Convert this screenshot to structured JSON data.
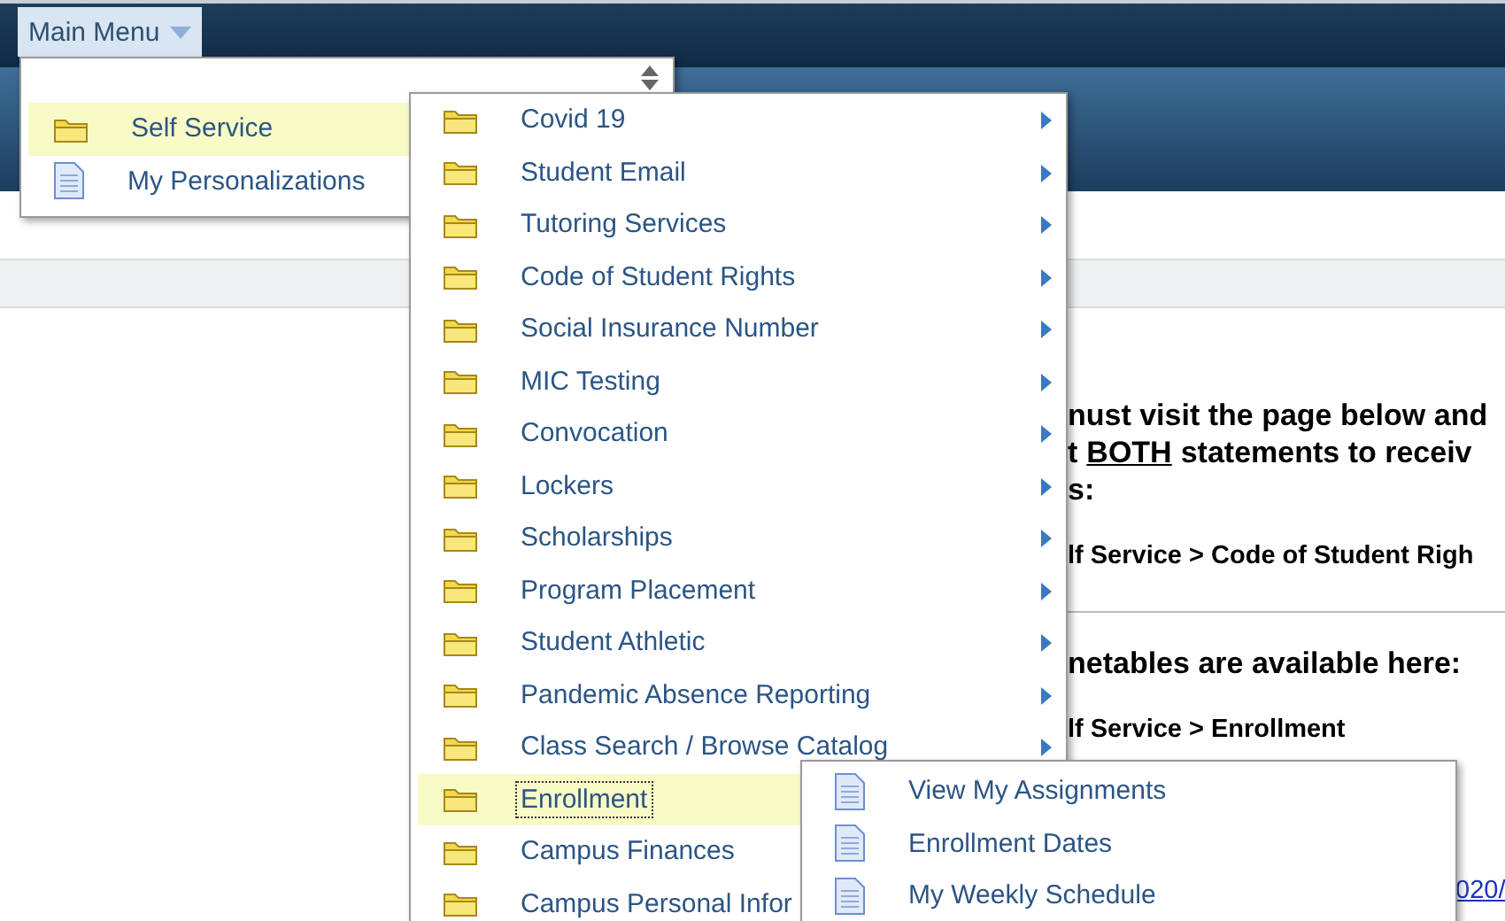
{
  "main_menu": {
    "label": "Main Menu"
  },
  "menu": {
    "items": [
      {
        "label": "Self Service",
        "kind": "folder",
        "selected": true
      },
      {
        "label": "My Personalizations",
        "kind": "page",
        "selected": false
      }
    ]
  },
  "submenu": {
    "items": [
      {
        "label": "Covid 19",
        "kind": "folder",
        "selected": false,
        "focused": false,
        "submenu": true
      },
      {
        "label": "Student Email",
        "kind": "folder",
        "selected": false,
        "focused": false,
        "submenu": true
      },
      {
        "label": "Tutoring Services",
        "kind": "folder",
        "selected": false,
        "focused": false,
        "submenu": true
      },
      {
        "label": "Code of Student Rights",
        "kind": "folder",
        "selected": false,
        "focused": false,
        "submenu": true
      },
      {
        "label": "Social Insurance Number",
        "kind": "folder",
        "selected": false,
        "focused": false,
        "submenu": true
      },
      {
        "label": "MIC Testing",
        "kind": "folder",
        "selected": false,
        "focused": false,
        "submenu": true
      },
      {
        "label": "Convocation",
        "kind": "folder",
        "selected": false,
        "focused": false,
        "submenu": true
      },
      {
        "label": "Lockers",
        "kind": "folder",
        "selected": false,
        "focused": false,
        "submenu": true
      },
      {
        "label": "Scholarships",
        "kind": "folder",
        "selected": false,
        "focused": false,
        "submenu": true
      },
      {
        "label": "Program Placement",
        "kind": "folder",
        "selected": false,
        "focused": false,
        "submenu": true
      },
      {
        "label": "Student Athletic",
        "kind": "folder",
        "selected": false,
        "focused": false,
        "submenu": true
      },
      {
        "label": "Pandemic Absence Reporting",
        "kind": "folder",
        "selected": false,
        "focused": false,
        "submenu": true
      },
      {
        "label": "Class Search / Browse Catalog",
        "kind": "folder",
        "selected": false,
        "focused": false,
        "submenu": true
      },
      {
        "label": "Enrollment",
        "kind": "folder",
        "selected": true,
        "focused": true
      },
      {
        "label": "Campus Finances",
        "kind": "folder",
        "selected": false,
        "focused": false
      },
      {
        "label": "Campus Personal Infor",
        "kind": "folder",
        "selected": false,
        "focused": false
      }
    ]
  },
  "enrollment_menu": {
    "items": [
      {
        "label": "View My Assignments",
        "kind": "page"
      },
      {
        "label": "Enrollment Dates",
        "kind": "page"
      },
      {
        "label": "My Weekly Schedule",
        "kind": "page"
      }
    ]
  },
  "content": {
    "blocks": [
      {
        "kind": "heading",
        "parts": [
          {
            "text": "nust visit the page below and"
          }
        ]
      },
      {
        "kind": "heading",
        "parts": [
          {
            "text": "t"
          },
          {
            "text": "BOTH",
            "underline": true
          },
          {
            "text": "statements to receiv"
          }
        ]
      },
      {
        "kind": "heading",
        "parts": [
          {
            "text": "s:"
          }
        ]
      },
      {
        "kind": "path",
        "parts": [
          {
            "text": "lf Service >  Code of Student Righ"
          }
        ]
      },
      {
        "kind": "divider"
      },
      {
        "kind": "heading",
        "parts": [
          {
            "text": "netables are available here:"
          }
        ]
      },
      {
        "kind": "path",
        "parts": [
          {
            "text": "lf Service > Enrollment"
          }
        ]
      },
      {
        "kind": "link",
        "parts": [
          {
            "text": "020/",
            "underline": true
          }
        ]
      }
    ]
  }
}
